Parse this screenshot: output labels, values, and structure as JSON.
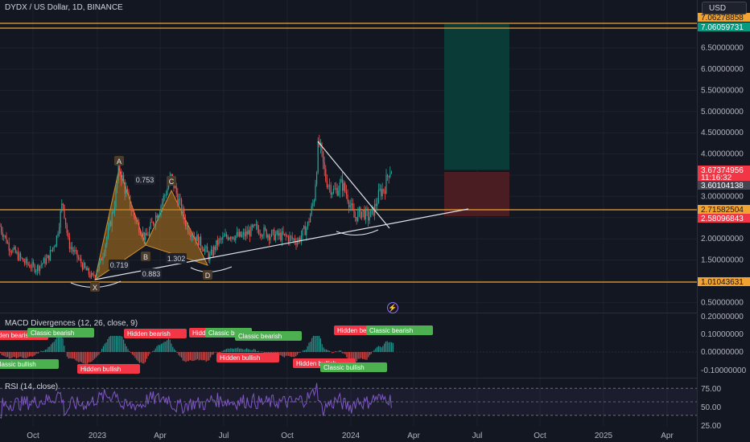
{
  "header": {
    "symbol": "DYDX / US Dollar, 1D, BINANCE",
    "currency_button": "USD",
    "macd_title": "MACD Divergences (12, 26, close, 9)",
    "rsi_title": "RSI (14, close)"
  },
  "colors": {
    "background": "#131722",
    "up": "#26a69a",
    "down": "#ef5350",
    "pattern_fill": "#b8791f",
    "hline": "#f0a331",
    "green_label": "#089981",
    "red_label": "#f23645",
    "rsi": "#7e57c2"
  },
  "chart_data": [
    {
      "type": "candlestick",
      "title": "DYDX / US Dollar, 1D, BINANCE",
      "x_ticks": [
        "Oct",
        "2023",
        "Apr",
        "Jul",
        "Oct",
        "2024",
        "Apr",
        "Jul",
        "Oct",
        "2025",
        "Apr"
      ],
      "y_ticks": [
        "6.50000000",
        "6.00000000",
        "5.50000000",
        "5.00000000",
        "4.50000000",
        "4.00000000",
        "3.50000000",
        "3.00000000",
        "2.50000000",
        "2.00000000",
        "1.50000000",
        "1.00000000",
        "0.50000000"
      ],
      "price_labels": [
        {
          "text": "7.06278858",
          "kind": "level"
        },
        {
          "text": "7.06059731",
          "kind": "target"
        },
        {
          "text": "3.67374956",
          "kind": "last"
        },
        {
          "text": "11:16:32",
          "kind": "countdown"
        },
        {
          "text": "3.60104138",
          "kind": "prev"
        },
        {
          "text": "2.71582504",
          "kind": "level"
        },
        {
          "text": "2.58096843",
          "kind": "stop"
        },
        {
          "text": "1.01043631",
          "kind": "level"
        }
      ],
      "horizontal_levels": [
        7.06278858,
        7.0275,
        2.71582504,
        1.01043631
      ],
      "harmonic_points": [
        {
          "label": "X",
          "price": 1.01
        },
        {
          "label": "A",
          "price": 3.7
        },
        {
          "label": "B",
          "price": 2.0
        },
        {
          "label": "C",
          "price": 3.45
        },
        {
          "label": "D",
          "price": 1.55
        }
      ],
      "harmonic_ratios": [
        "0.753",
        "0.719",
        "1.302",
        "0.883"
      ],
      "position": {
        "entry": 2.71582504,
        "target": 7.06059731,
        "stop": 2.58096843
      },
      "series": [
        {
          "anchors": [
            [
              0,
              2.3
            ],
            [
              12,
              1.8
            ],
            [
              30,
              1.45
            ],
            [
              45,
              1.3
            ],
            [
              60,
              1.55
            ],
            [
              70,
              2.0
            ],
            [
              78,
              2.9
            ],
            [
              85,
              1.9
            ],
            [
              95,
              1.6
            ],
            [
              105,
              1.3
            ],
            [
              115,
              1.08
            ],
            [
              125,
              1.45
            ],
            [
              135,
              2.2
            ],
            [
              142,
              2.8
            ],
            [
              148,
              3.7
            ],
            [
              155,
              3.2
            ],
            [
              165,
              2.6
            ],
            [
              175,
              2.2
            ],
            [
              181,
              2.0
            ],
            [
              190,
              2.4
            ],
            [
              200,
              2.8
            ],
            [
              213,
              3.45
            ],
            [
              222,
              2.9
            ],
            [
              232,
              2.3
            ],
            [
              245,
              2.0
            ],
            [
              255,
              1.75
            ],
            [
              260,
              1.55
            ],
            [
              270,
              1.9
            ],
            [
              285,
              2.1
            ],
            [
              300,
              2.05
            ],
            [
              318,
              2.25
            ],
            [
              335,
              2.1
            ],
            [
              355,
              2.05
            ],
            [
              370,
              1.95
            ],
            [
              382,
              2.3
            ],
            [
              390,
              2.9
            ],
            [
              396,
              4.3
            ],
            [
              405,
              3.4
            ],
            [
              415,
              3.1
            ],
            [
              425,
              3.3
            ],
            [
              432,
              3.0
            ],
            [
              440,
              2.5
            ],
            [
              450,
              2.65
            ],
            [
              458,
              2.5
            ],
            [
              465,
              2.7
            ],
            [
              472,
              3.1
            ],
            [
              478,
              3.2
            ],
            [
              483,
              3.6
            ],
            [
              488,
              3.67
            ]
          ]
        }
      ]
    },
    {
      "type": "histogram",
      "title": "MACD Divergences (12, 26, close, 9)",
      "y_ticks": [
        "0.20000000",
        "0.10000000",
        "0.00000000",
        "-0.10000000"
      ],
      "annotations": [
        {
          "text": "Hidden bearish",
          "kind": "bear"
        },
        {
          "text": "Classic bearish",
          "kind": "bull"
        },
        {
          "text": "Classic bullish",
          "kind": "bull"
        },
        {
          "text": "Hidden bearish",
          "kind": "bear"
        },
        {
          "text": "Hidden bullish",
          "kind": "bear"
        },
        {
          "text": "Hidden bearish",
          "kind": "bear"
        },
        {
          "text": "Classic be",
          "kind": "bull"
        },
        {
          "text": "Classic bearish",
          "kind": "bull"
        },
        {
          "text": "Hidden bullish",
          "kind": "bear"
        },
        {
          "text": "Hidden bullish",
          "kind": "bear"
        },
        {
          "text": "Classic bullish",
          "kind": "bull"
        },
        {
          "text": "Hidden bea",
          "kind": "bear"
        },
        {
          "text": "Classic bearish",
          "kind": "bull"
        }
      ]
    },
    {
      "type": "line",
      "title": "RSI (14, close)",
      "y_ticks": [
        "75.00",
        "50.00",
        "25.00"
      ],
      "ylim": [
        25,
        75
      ]
    }
  ]
}
